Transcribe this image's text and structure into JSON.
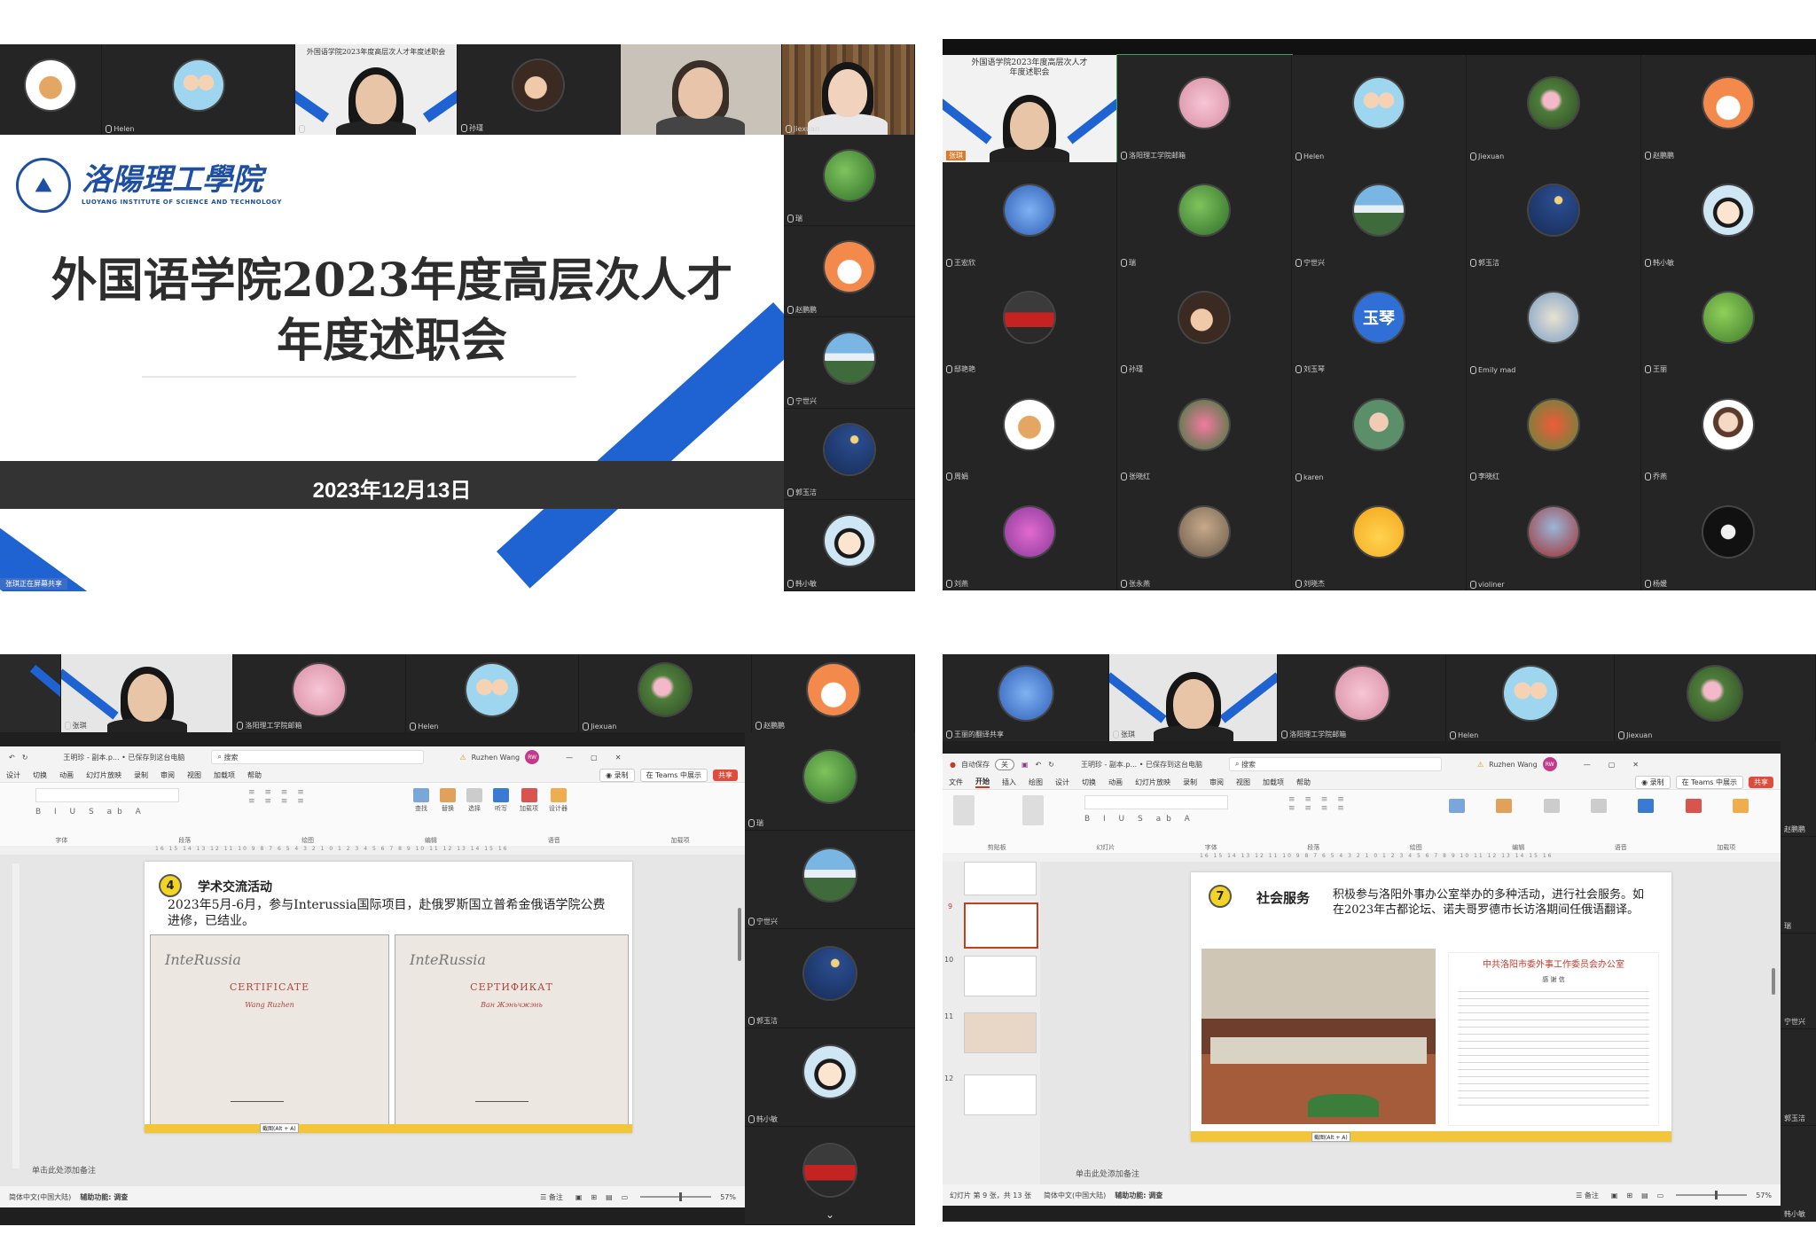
{
  "panel1": {
    "strip_names": [
      "Helen",
      "",
      "孙瑾",
      "",
      "Jiexuan"
    ],
    "side_names": [
      "瑞",
      "赵鹏鹏",
      "宁世兴",
      "郭玉洁",
      "韩小敏"
    ],
    "sharing_label": "张琪正在屏幕共享",
    "school_cn": "洛陽理工學院",
    "school_en": "LUOYANG INSTITUTE OF SCIENCE AND TECHNOLOGY",
    "title_line1": "外国语学院2023年度高层次人才",
    "title_line2": "年度述职会",
    "date": "2023年12月13日",
    "small_slide_title": "外国语学院2023年度高层次人才年度述职会"
  },
  "panel2": {
    "shared_title_line1": "外国语学院2023年度高层次人才",
    "shared_title_line2": "年度述职会",
    "avatar_text": "玉琴",
    "names": [
      "张琪",
      "洛阳理工学院邮箱",
      "Helen",
      "Jiexuan",
      "赵鹏鹏",
      "王宏欣",
      "瑞",
      "宁世兴",
      "郭玉洁",
      "韩小敏",
      "邸艳艳",
      "孙瑾",
      "刘玉琴",
      "Emily mad",
      "王丽",
      "周娟",
      "张晓红",
      "karen",
      "李晓红",
      "乔燕",
      "刘燕",
      "张永燕",
      "刘晓杰",
      "violiner",
      "杨媛"
    ]
  },
  "panel3": {
    "strip_names": [
      "张琪",
      "洛阳理工学院邮箱",
      "Helen",
      "Jiexuan",
      "赵鹏鹏"
    ],
    "side_names": [
      "瑞",
      "宁世兴",
      "郭玉洁",
      "韩小敏",
      ""
    ],
    "ppt": {
      "titlebar_file": "王明珍 - 副本.p... • 已保存到这台电脑",
      "search": "搜索",
      "user": "Ruzhen Wang",
      "user_initials": "RW",
      "menu": [
        "设计",
        "切换",
        "动画",
        "幻灯片放映",
        "录制",
        "审阅",
        "视图",
        "加载项",
        "帮助"
      ],
      "record": "录制",
      "teams": "在 Teams 中展示",
      "share": "共享",
      "groups": [
        "字体",
        "段落",
        "绘图",
        "编辑",
        "语音",
        "加载项"
      ],
      "ribbon_right": [
        "查找",
        "替换",
        "选择",
        "听写",
        "加载项",
        "设计器"
      ],
      "slide_num": "4",
      "slide_heading": "学术交流活动",
      "slide_text": "2023年5月-6月，参与Interussia国际项目，赴俄罗斯国立普希金俄语学院公费进修，已结业。",
      "cert1_brand": "InteRussia",
      "cert1_title": "CERTIFICATE",
      "cert1_name": "Wang Ruzhen",
      "cert2_brand": "InteRussia",
      "cert2_title": "СЕРТИФИКАТ",
      "cert2_name": "Ван Жэньчжэнь",
      "notes": "单击此处添加备注",
      "status_lang": "简体中文(中国大陆)",
      "status_access": "辅助功能: 调查",
      "status_notes": "备注",
      "zoom": "57%",
      "photo_label": "截图(Alt + A)"
    }
  },
  "panel4": {
    "strip_names": [
      "王丽的翻译共享",
      "张琪",
      "洛阳理工学院邮箱",
      "Helen",
      "Jiexuan"
    ],
    "side_names": [
      "赵鹏鹏",
      "瑞",
      "宁世兴",
      "郭玉洁",
      "韩小敏"
    ],
    "ppt": {
      "autosave": "自动保存",
      "autosave_state": "关",
      "titlebar_file": "王明珍 - 副本.p... • 已保存到这台电脑",
      "search": "搜索",
      "user": "Ruzhen Wang",
      "user_initials": "RW",
      "menu": [
        "文件",
        "开始",
        "插入",
        "绘图",
        "设计",
        "切换",
        "动画",
        "幻灯片放映",
        "录制",
        "审阅",
        "视图",
        "加载项",
        "帮助"
      ],
      "record": "录制",
      "teams": "在 Teams 中展示",
      "share": "共享",
      "groups": [
        "剪贴板",
        "幻灯片",
        "字体",
        "段落",
        "绘图",
        "编辑",
        "语音",
        "加载项"
      ],
      "thumb_nums": [
        "9",
        "10",
        "11",
        "12"
      ],
      "slide_num": "7",
      "slide_heading": "社会服务",
      "slide_text": "积极参与洛阳外事办公室举办的多种活动，进行社会服务。如在2023年古都论坛、诺夫哥罗德市长访洛期间任俄语翻译。",
      "letter_title": "中共洛阳市委外事工作委员会办公室",
      "letter_sub": "感 谢 信",
      "notes": "单击此处添加备注",
      "status_slide": "幻灯片 第 9 张，共 13 张",
      "status_lang": "简体中文(中国大陆)",
      "status_access": "辅助功能: 调查",
      "status_notes": "备注",
      "zoom": "57%",
      "photo_label": "截图(Alt + A)"
    }
  }
}
